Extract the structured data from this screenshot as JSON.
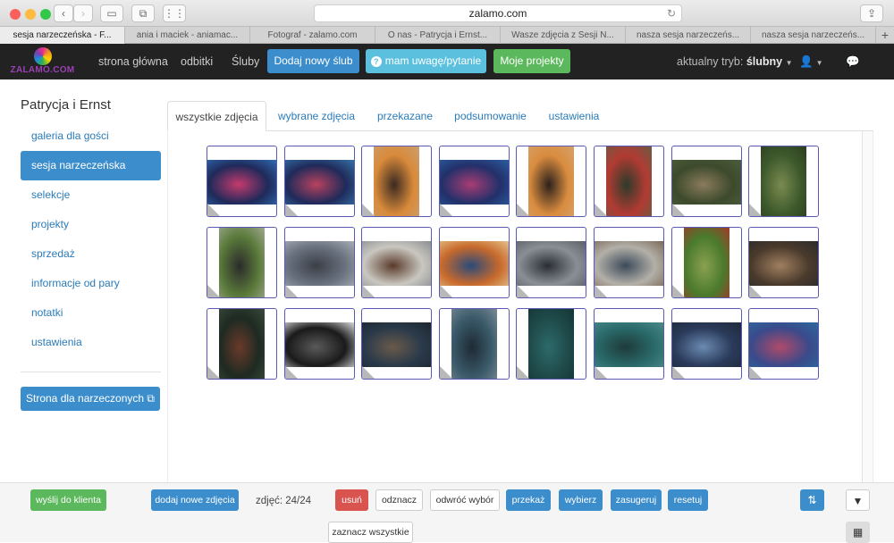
{
  "browser": {
    "url": "zalamo.com",
    "tabs": [
      {
        "label": "sesja narzeczeńska - F..."
      },
      {
        "label": "ania i maciek - aniamac..."
      },
      {
        "label": "Fotograf - zalamo.com"
      },
      {
        "label": "O nas - Patrycja i Ernst..."
      },
      {
        "label": "Wasze zdjęcia z Sesji N..."
      },
      {
        "label": "nasza sesja narzeczeńs..."
      },
      {
        "label": "nasza sesja narzeczeńs..."
      }
    ],
    "new_tab": "+"
  },
  "nav": {
    "logo_text": "ZALAMO.COM",
    "links": [
      "strona główna",
      "odbitki",
      "Śluby"
    ],
    "add_wedding": "Dodaj nowy ślub",
    "feedback": "mam uwagę/pytanie",
    "projects": "Moje projekty",
    "mode_label": "aktualny tryb:",
    "mode_value": "ślubny"
  },
  "sidebar": {
    "title": "Patrycja i Ernst",
    "items": [
      {
        "label": "galeria dla gości"
      },
      {
        "label": "sesja narzeczeńska"
      },
      {
        "label": "selekcje"
      },
      {
        "label": "projekty"
      },
      {
        "label": "sprzedaż"
      },
      {
        "label": "informacje od pary"
      },
      {
        "label": "notatki"
      },
      {
        "label": "ustawienia"
      }
    ],
    "couple_page": "Strona dla narzeczonych"
  },
  "content_tabs": [
    {
      "label": "wszystkie zdjęcia"
    },
    {
      "label": "wybrane zdjęcia"
    },
    {
      "label": "przekazane"
    },
    {
      "label": "podsumowanie"
    },
    {
      "label": "ustawienia"
    }
  ],
  "photos": [
    {
      "orient": "landscape",
      "colors": [
        "#1f2a5a",
        "#c53a6d",
        "#2f6bb0"
      ]
    },
    {
      "orient": "landscape",
      "colors": [
        "#1f2a5a",
        "#b8425e",
        "#3572a8"
      ]
    },
    {
      "orient": "portrait",
      "colors": [
        "#d88a3a",
        "#3b2a22",
        "#caa070"
      ]
    },
    {
      "orient": "landscape",
      "colors": [
        "#22306a",
        "#a83c73",
        "#2b5ea0"
      ]
    },
    {
      "orient": "portrait",
      "colors": [
        "#d98c3f",
        "#2c211c",
        "#d6a26a"
      ]
    },
    {
      "orient": "portrait",
      "colors": [
        "#b23b33",
        "#2d3b2a",
        "#6b5a46"
      ]
    },
    {
      "orient": "landscape",
      "colors": [
        "#3d4a2c",
        "#8a7b5c",
        "#4b5e3a"
      ]
    },
    {
      "orient": "portrait",
      "colors": [
        "#3e5a2c",
        "#7a8a50",
        "#2c3d20"
      ]
    },
    {
      "orient": "portrait",
      "colors": [
        "#5a7a3a",
        "#2b2b2b",
        "#a0a890"
      ]
    },
    {
      "orient": "landscape",
      "colors": [
        "#6a7280",
        "#3b3f46",
        "#a8aeb6"
      ]
    },
    {
      "orient": "landscape",
      "colors": [
        "#c9c7c0",
        "#5a3a2a",
        "#8a8e92"
      ]
    },
    {
      "orient": "landscape",
      "colors": [
        "#c86a2c",
        "#2a4a7a",
        "#e4c28a"
      ]
    },
    {
      "orient": "landscape",
      "colors": [
        "#8a8f96",
        "#2a2e34",
        "#5a6066"
      ]
    },
    {
      "orient": "landscape",
      "colors": [
        "#b3b0a8",
        "#3b4a5a",
        "#7a6a5a"
      ]
    },
    {
      "orient": "portrait",
      "colors": [
        "#4a7a2c",
        "#8aa050",
        "#a03a2a"
      ]
    },
    {
      "orient": "landscape",
      "colors": [
        "#4a3a2c",
        "#a08060",
        "#2b2b2b"
      ]
    },
    {
      "orient": "portrait",
      "colors": [
        "#1e2a22",
        "#6a3a2a",
        "#3a4a3a"
      ]
    },
    {
      "orient": "landscape",
      "colors": [
        "#1a1a1a",
        "#5a5a5a",
        "#d8d8d8"
      ]
    },
    {
      "orient": "landscape",
      "colors": [
        "#2a3a4a",
        "#6a5a4a",
        "#1e2630"
      ]
    },
    {
      "orient": "portrait",
      "colors": [
        "#3a5a6a",
        "#1e2a34",
        "#7a8a96"
      ]
    },
    {
      "orient": "portrait",
      "colors": [
        "#1f4a4a",
        "#2d6a6a",
        "#143434"
      ]
    },
    {
      "orient": "landscape",
      "colors": [
        "#2a6a6a",
        "#1e3a3a",
        "#4a8a8a"
      ]
    },
    {
      "orient": "landscape",
      "colors": [
        "#2a3a5a",
        "#6a8ab0",
        "#1e2a3a"
      ]
    },
    {
      "orient": "landscape",
      "colors": [
        "#3a4a8a",
        "#b04a6a",
        "#2a6aa0"
      ]
    }
  ],
  "actions": {
    "send_to_client": "wyślij do klienta",
    "add_photos": "dodaj nowe zdjęcia",
    "count": "zdjęć: 24/24",
    "delete": "usuń",
    "unmark": "odznacz",
    "invert": "odwróć wybór",
    "transfer": "przekaż",
    "select": "wybierz",
    "suggest": "zasugeruj",
    "reset": "resetuj",
    "select_all": "zaznacz wszystkie"
  },
  "colors": {
    "accent_blue": "#3c8dcb",
    "green": "#5cb85c",
    "danger": "#d9534f",
    "info": "#5bc0de",
    "navbar": "#222222"
  }
}
